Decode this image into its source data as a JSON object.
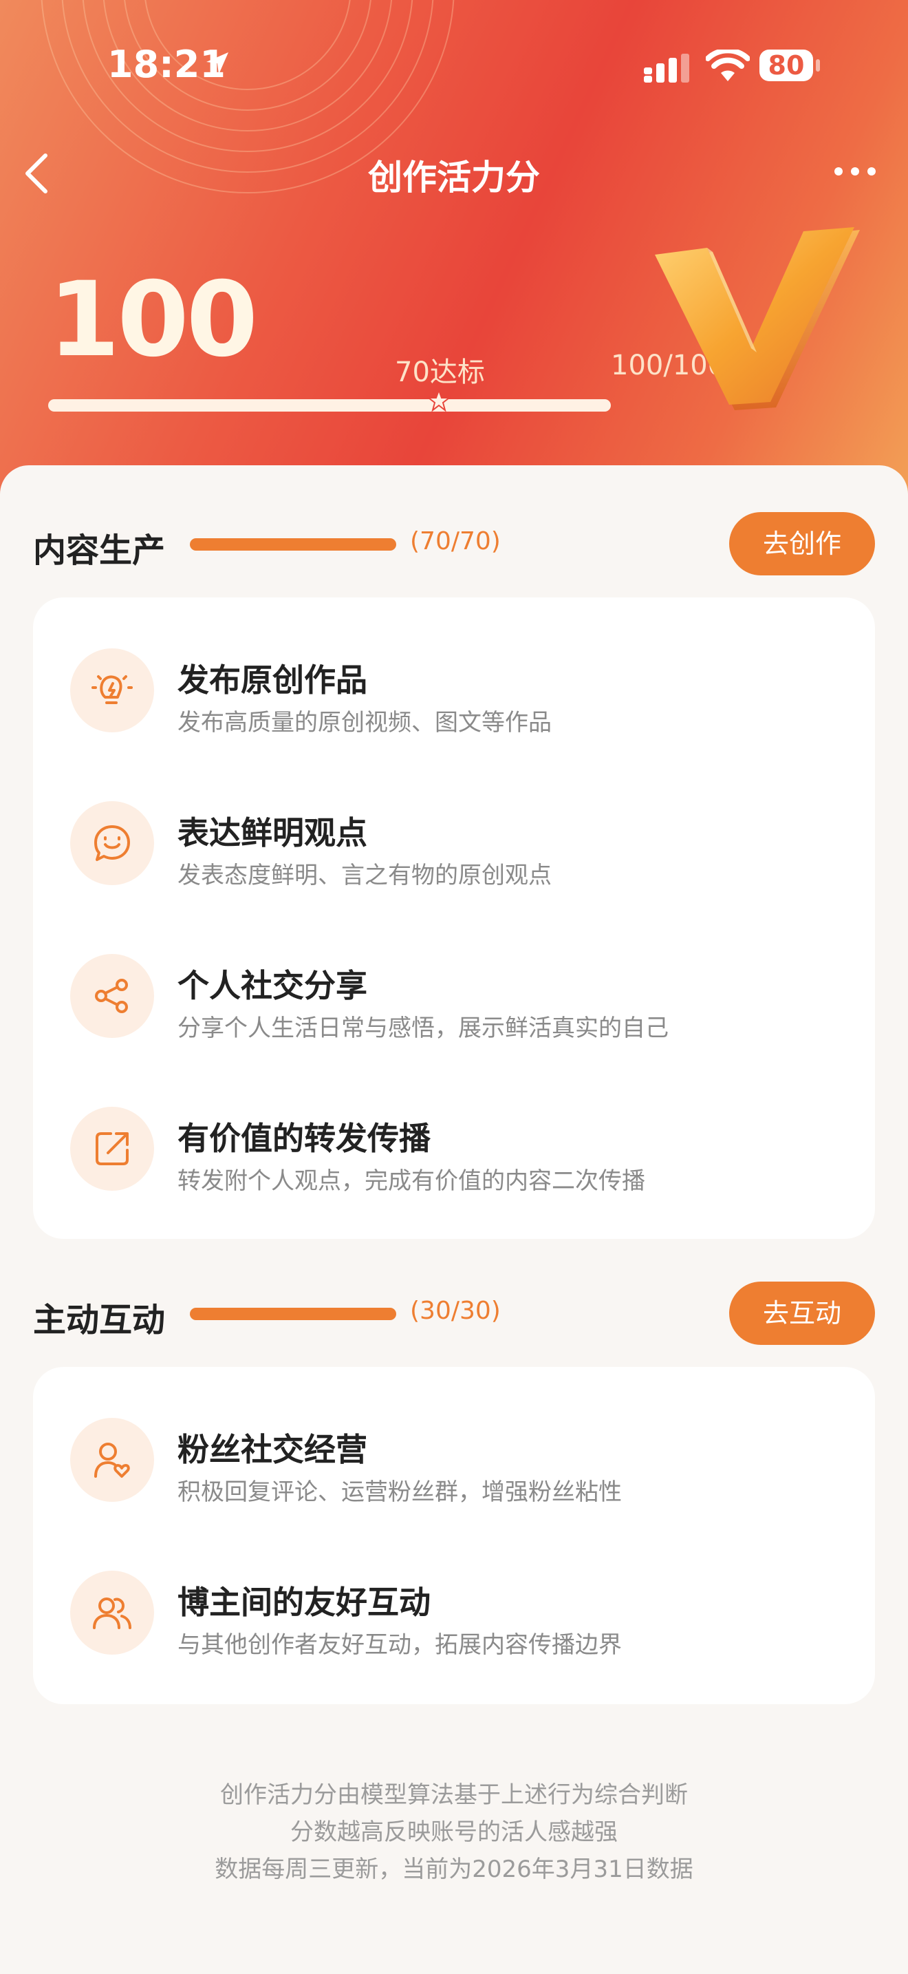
{
  "status_bar": {
    "time": "18:21",
    "battery": "80"
  },
  "nav": {
    "title": "创作活力分"
  },
  "score": {
    "value": "100",
    "threshold_label": "70达标",
    "progress_label": "100/100",
    "fill_fraction": 1.0
  },
  "sections": [
    {
      "title": "内容生产",
      "count": "(70/70)",
      "button": "去创作",
      "fill_fraction": 1.0,
      "items": [
        {
          "icon": "lightbulb-icon",
          "title": "发布原创作品",
          "subtitle": "发布高质量的原创视频、图文等作品"
        },
        {
          "icon": "smile-chat-icon",
          "title": "表达鲜明观点",
          "subtitle": "发表态度鲜明、言之有物的原创观点"
        },
        {
          "icon": "share-icon",
          "title": "个人社交分享",
          "subtitle": "分享个人生活日常与感悟，展示鲜活真实的自己"
        },
        {
          "icon": "forward-icon",
          "title": "有价值的转发传播",
          "subtitle": "转发附个人观点，完成有价值的内容二次传播"
        }
      ]
    },
    {
      "title": "主动互动",
      "count": "(30/30)",
      "button": "去互动",
      "fill_fraction": 1.0,
      "items": [
        {
          "icon": "user-heart-icon",
          "title": "粉丝社交经营",
          "subtitle": "积极回复评论、运营粉丝群，增强粉丝粘性"
        },
        {
          "icon": "users-icon",
          "title": "博主间的友好互动",
          "subtitle": "与其他创作者友好互动，拓展内容传播边界"
        }
      ]
    }
  ],
  "footer": {
    "lines": [
      "创作活力分由模型算法基于上述行为综合判断",
      "分数越高反映账号的活人感越强",
      "数据每周三更新，当前为2026年3月31日数据"
    ]
  },
  "colors": {
    "accent": "#ee7e31",
    "hero_red": "#e8453a",
    "icon_bg": "#fdeee3"
  }
}
